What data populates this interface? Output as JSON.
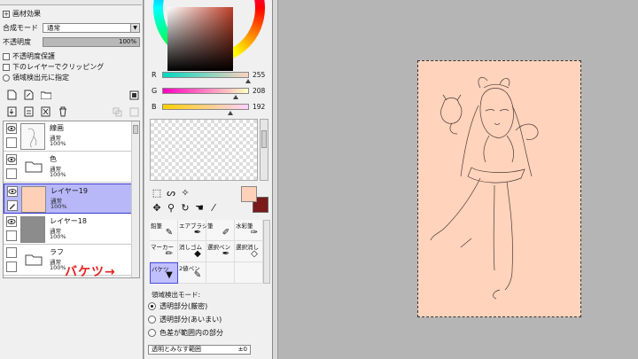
{
  "left_panel": {
    "section_title": "画材効果",
    "blend_mode_label": "合成モード",
    "blend_mode_value": "通常",
    "opacity_label": "不透明度",
    "opacity_value": "100%",
    "preserve_opacity": "不透明度保護",
    "clip_lower": "下のレイヤーでクリッピング",
    "selection_source": "領域検出元に指定",
    "layers": [
      {
        "name": "線画",
        "mode": "通常",
        "opacity": "100%",
        "type": "layer",
        "selected": false
      },
      {
        "name": "色",
        "mode": "通常",
        "opacity": "100%",
        "type": "folder",
        "selected": false
      },
      {
        "name": "レイヤー19",
        "mode": "通常",
        "opacity": "100%",
        "type": "layer",
        "selected": true
      },
      {
        "name": "レイヤー18",
        "mode": "通常",
        "opacity": "100%",
        "type": "layer",
        "selected": false
      },
      {
        "name": "ラフ",
        "mode": "通常",
        "opacity": "100%",
        "type": "folder",
        "selected": false
      }
    ],
    "callout": "バケツ→"
  },
  "color": {
    "r_label": "R",
    "r_value": "255",
    "g_label": "G",
    "g_value": "208",
    "b_label": "B",
    "b_value": "192",
    "fg": "#ffd0b8",
    "bg": "#7a1a1a"
  },
  "tools": [
    {
      "label": "鉛筆",
      "icon": "pencil-icon",
      "glyph": "✎",
      "selected": false
    },
    {
      "label": "エアブラシ",
      "icon": "airbrush-icon",
      "glyph": "✒",
      "selected": false
    },
    {
      "label": "筆",
      "icon": "brush-icon",
      "glyph": "✐",
      "selected": false
    },
    {
      "label": "水彩筆",
      "icon": "watercolor-icon",
      "glyph": "✑",
      "selected": false
    },
    {
      "label": "マーカー",
      "icon": "marker-icon",
      "glyph": "✏",
      "selected": false
    },
    {
      "label": "消しゴム",
      "icon": "eraser-icon",
      "glyph": "◆",
      "selected": false
    },
    {
      "label": "選択ペン",
      "icon": "select-pen-icon",
      "glyph": "✒",
      "selected": false
    },
    {
      "label": "選択消し",
      "icon": "select-erase-icon",
      "glyph": "◇",
      "selected": false
    },
    {
      "label": "バケツ",
      "icon": "bucket-icon",
      "glyph": "▼",
      "selected": true
    },
    {
      "label": "2値ペン",
      "icon": "binary-pen-icon",
      "glyph": "✎",
      "selected": false
    },
    {
      "label": "",
      "icon": "",
      "glyph": "",
      "selected": false
    },
    {
      "label": "",
      "icon": "",
      "glyph": "",
      "selected": false
    }
  ],
  "detection": {
    "title": "領域検出モード:",
    "options": [
      {
        "label": "透明部分(厳密)",
        "checked": true
      },
      {
        "label": "透明部分(あいまい)",
        "checked": false
      },
      {
        "label": "色差が範囲内の部分",
        "checked": false
      }
    ],
    "tolerance_label": "透明とみなす範囲",
    "tolerance_value": "±0"
  },
  "canvas": {
    "paper_color": "#ffd3bc"
  }
}
